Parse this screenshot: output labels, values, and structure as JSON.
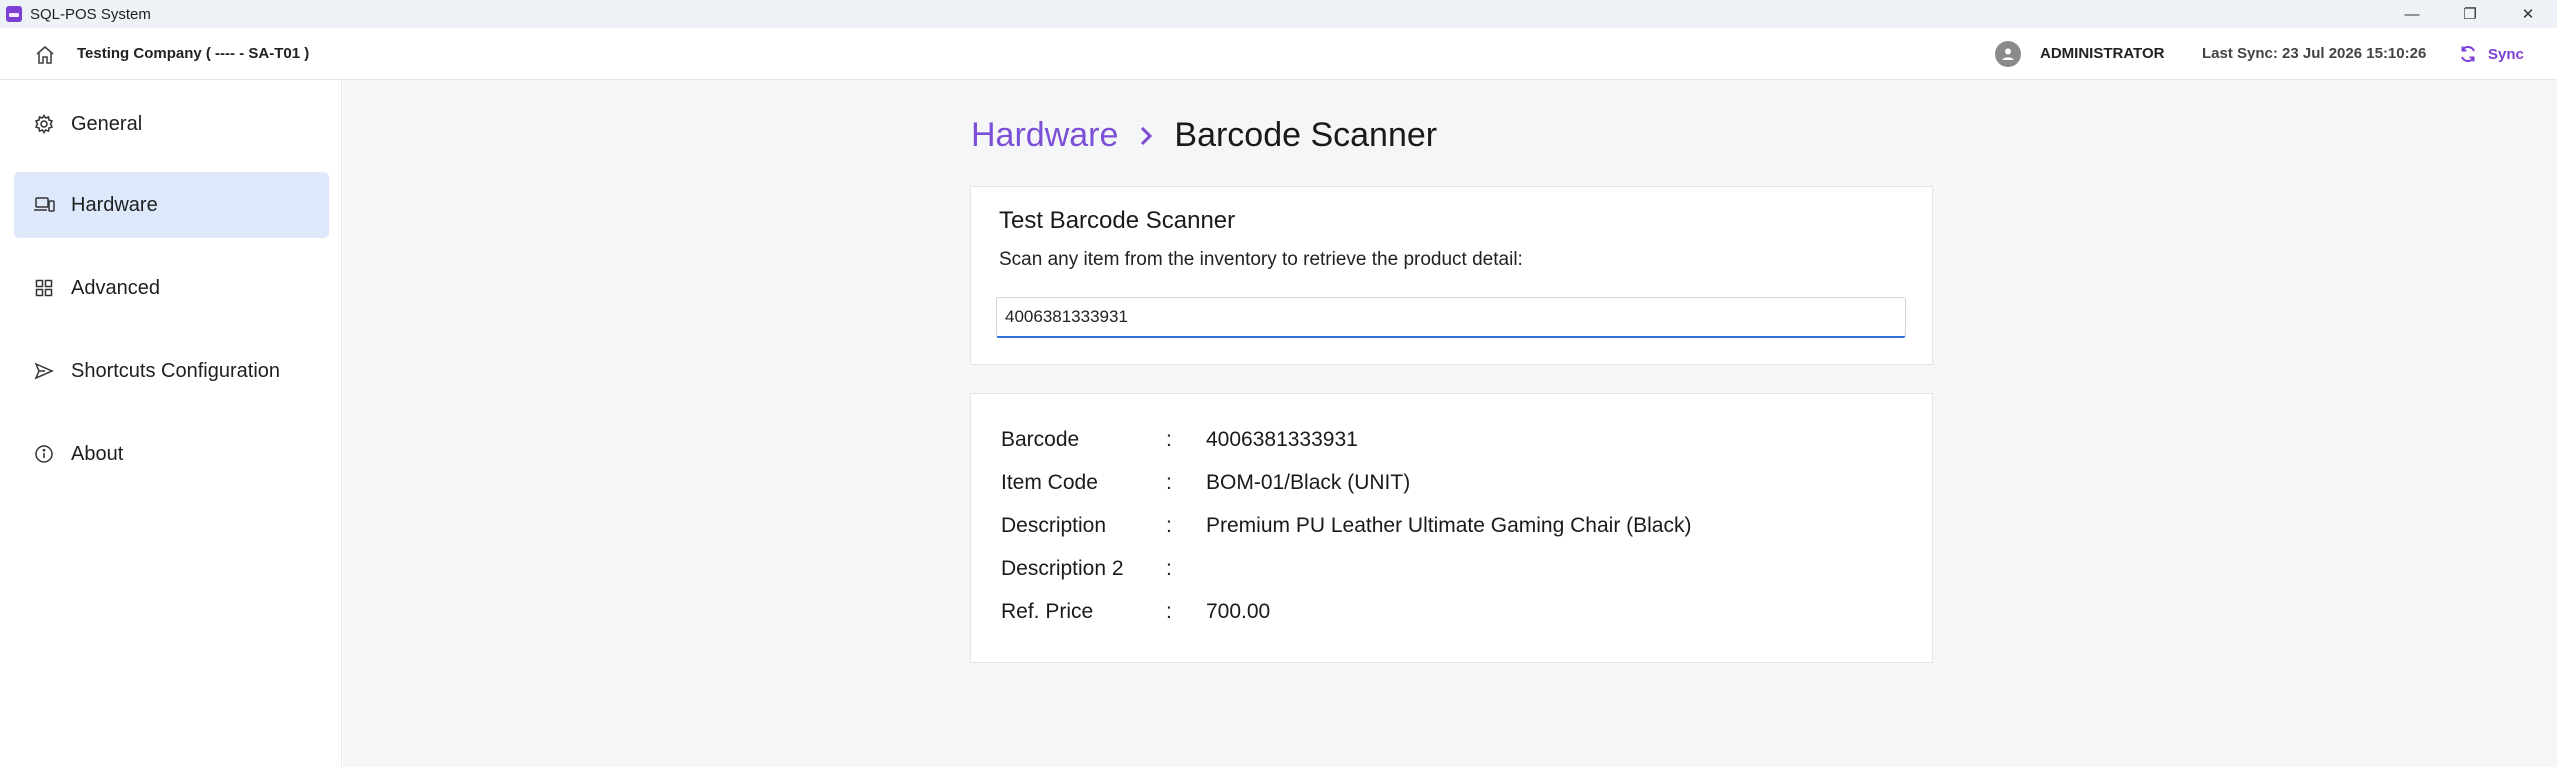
{
  "window": {
    "title": "SQL-POS System",
    "controls": {
      "minimize": "—",
      "restore": "❐",
      "close": "✕"
    }
  },
  "header": {
    "home_icon": "home-icon",
    "company": "Testing Company ( ---- - SA-T01 )",
    "user_icon": "user-avatar-icon",
    "user": "ADMINISTRATOR",
    "last_sync": "Last Sync: 23 Jul 2026 15:10:26",
    "sync_label": "Sync",
    "accent_color": "#7b3fd6"
  },
  "sidebar": {
    "items": [
      {
        "label": "General",
        "icon": "gear-icon",
        "active": false
      },
      {
        "label": "Hardware",
        "icon": "devices-icon",
        "active": true
      },
      {
        "label": "Advanced",
        "icon": "grid-icon",
        "active": false
      },
      {
        "label": "Shortcuts Configuration",
        "icon": "send-icon",
        "active": false
      },
      {
        "label": "About",
        "icon": "info-icon",
        "active": false
      }
    ]
  },
  "breadcrumb": {
    "parent": "Hardware",
    "current": "Barcode Scanner"
  },
  "scanner_card": {
    "title": "Test Barcode Scanner",
    "description": "Scan any item from the inventory to retrieve the product detail:",
    "input_value": "4006381333931"
  },
  "product_detail": {
    "rows": [
      {
        "label": "Barcode",
        "value": "4006381333931"
      },
      {
        "label": "Item Code",
        "value": "BOM-01/Black (UNIT)"
      },
      {
        "label": "Description",
        "value": "Premium PU Leather Ultimate Gaming Chair (Black)"
      },
      {
        "label": "Description 2",
        "value": ""
      },
      {
        "label": "Ref. Price",
        "value": "700.00"
      }
    ],
    "separator": ":"
  }
}
